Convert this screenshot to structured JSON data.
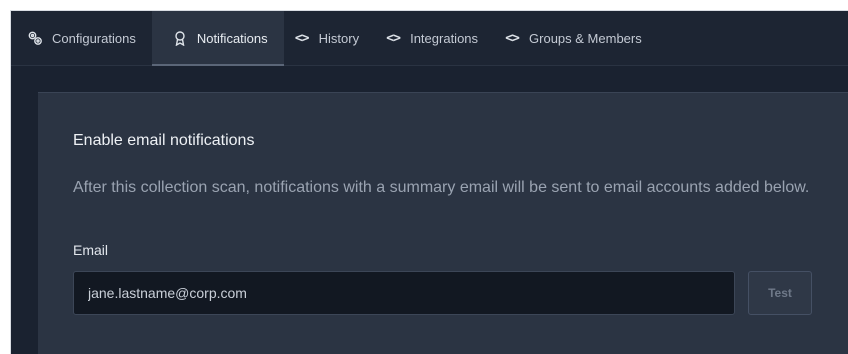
{
  "tabs": [
    {
      "label": "Configurations",
      "icon": "gears-icon",
      "active": false
    },
    {
      "label": "Notifications",
      "icon": "award-ribbon-icon",
      "active": true
    },
    {
      "label": "History",
      "icon": "code-brackets-icon",
      "active": false
    },
    {
      "label": "Integrations",
      "icon": "code-brackets-icon",
      "active": false
    },
    {
      "label": "Groups & Members",
      "icon": "code-brackets-icon",
      "active": false
    }
  ],
  "panel": {
    "title": "Enable email notifications",
    "description": "After this collection scan, notifications with a summary email will be sent to email accounts added below.",
    "email_label": "Email",
    "email_value": "jane.lastname@corp.com",
    "test_label": "Test"
  },
  "colors": {
    "background": "#1a2230",
    "panel": "#2b3443",
    "input": "#121822"
  }
}
